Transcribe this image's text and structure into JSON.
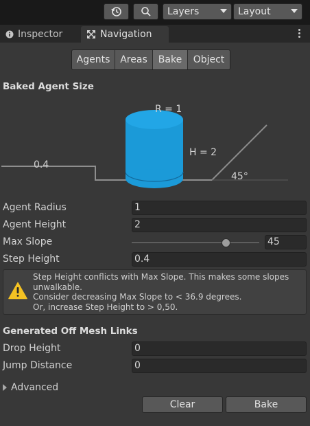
{
  "toolbar": {
    "history_icon": "history-icon",
    "search_icon": "search-icon",
    "layers": "Layers",
    "layout": "Layout"
  },
  "tabs": {
    "inspector": "Inspector",
    "navigation": "Navigation"
  },
  "segments": [
    "Agents",
    "Areas",
    "Bake",
    "Object"
  ],
  "selected_segment": "Bake",
  "baked_agent_size": {
    "header": "Baked Agent Size",
    "radius_label": "R = 1",
    "height_label": "H = 2",
    "step_label": "0.4",
    "slope_label": "45°"
  },
  "fields": {
    "agent_radius": {
      "label": "Agent Radius",
      "value": "1"
    },
    "agent_height": {
      "label": "Agent Height",
      "value": "2"
    },
    "max_slope": {
      "label": "Max Slope",
      "value": "45",
      "slider_min": 0,
      "slider_max": 60
    },
    "step_height": {
      "label": "Step Height",
      "value": "0.4"
    }
  },
  "warning": {
    "line1": "Step Height conflicts with Max Slope. This makes some slopes unwalkable.",
    "line2": "Consider decreasing Max Slope to < 36.9 degrees.",
    "line3": "Or, increase Step Height to > 0,50."
  },
  "off_mesh": {
    "header": "Generated Off Mesh Links",
    "drop_height": {
      "label": "Drop Height",
      "value": "0"
    },
    "jump_distance": {
      "label": "Jump Distance",
      "value": "0"
    }
  },
  "advanced": "Advanced",
  "buttons": {
    "clear": "Clear",
    "bake": "Bake"
  },
  "colors": {
    "agent_cylinder": "#1b9ad8",
    "warning_yellow": "#f4c223"
  }
}
